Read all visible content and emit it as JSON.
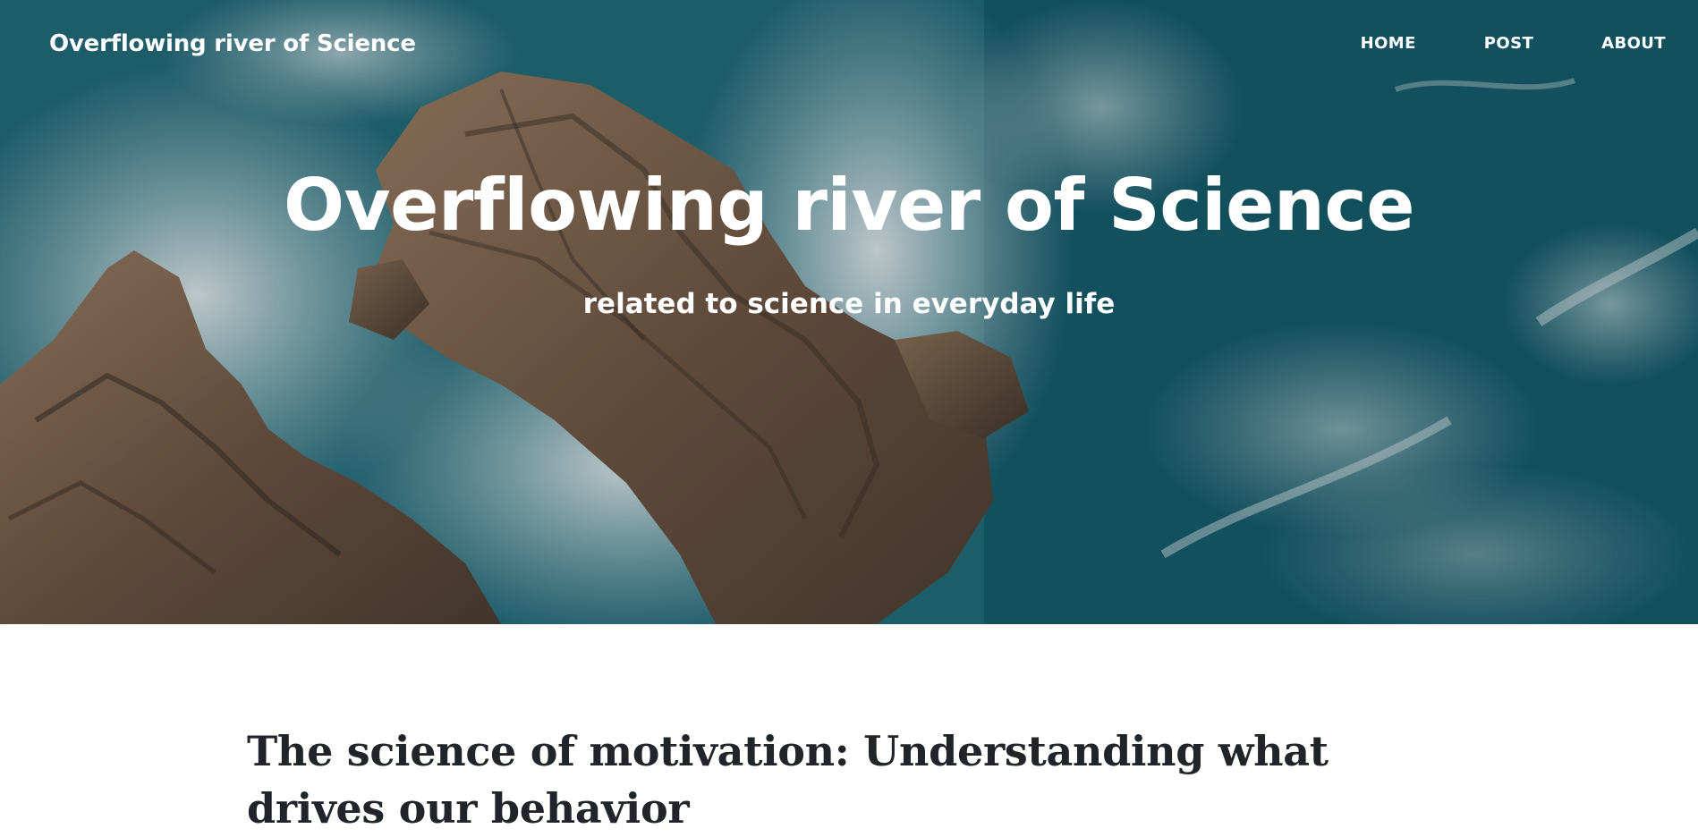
{
  "navbar": {
    "brand": "Overflowing river of Science",
    "links": [
      {
        "label": "HOME"
      },
      {
        "label": "POST"
      },
      {
        "label": "ABOUT"
      }
    ]
  },
  "header": {
    "title": "Overflowing river of Science",
    "subtitle": "related to science in everyday life"
  },
  "posts": [
    {
      "title": "The science of motivation: Understanding what drives our behavior"
    }
  ],
  "colors": {
    "ocean": "#1f6a78",
    "rock": "#7a5c44",
    "foam": "#dfe9ec",
    "text_dark": "#212529",
    "text_light": "#ffffff"
  }
}
